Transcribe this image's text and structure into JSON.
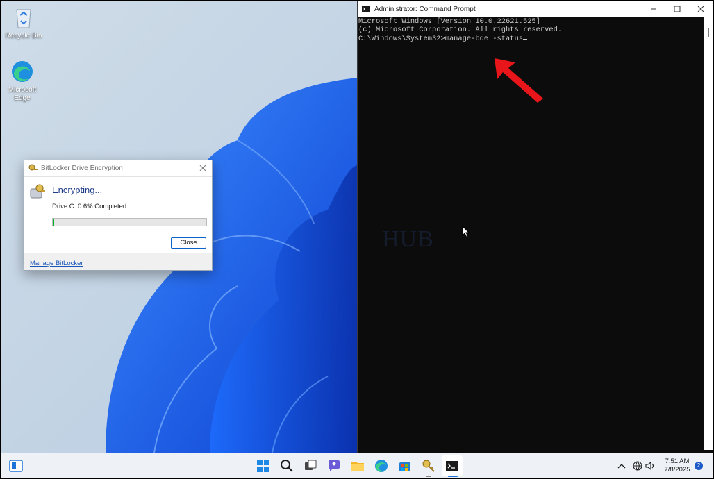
{
  "desktop": {
    "icons": [
      {
        "label": "Recycle Bin",
        "icon": "recycle-bin-icon"
      },
      {
        "label": "Microsoft Edge",
        "icon": "edge-icon"
      }
    ]
  },
  "bitlocker_dialog": {
    "title": "BitLocker Drive Encryption",
    "heading": "Encrypting...",
    "status": "Drive C: 0.6% Completed",
    "progress_percent": 0.6,
    "close_label": "Close",
    "link_label": "Manage BitLocker",
    "colors": {
      "progress": "#06b025",
      "heading": "#1f3c8a",
      "link": "#1a56b8"
    }
  },
  "cmd_window": {
    "title": "Administrator: Command Prompt",
    "lines": [
      "Microsoft Windows [Version 10.0.22621.525]",
      "(c) Microsoft Corporation. All rights reserved.",
      "",
      "C:\\Windows\\System32>manage-bde -status"
    ],
    "annotation": "red-arrow-pointing-to-command",
    "colors": {
      "background": "#0c0c0c",
      "text": "#cccccc",
      "arrow": "#e8161b"
    }
  },
  "watermark": "HUB",
  "taskbar": {
    "icons": [
      "widgets-icon",
      "start-icon",
      "search-icon",
      "task-view-icon",
      "chat-icon",
      "file-explorer-icon",
      "edge-icon",
      "store-icon",
      "bitlocker-icon",
      "cmd-icon"
    ],
    "tray": [
      "chevron-up-icon",
      "network-icon",
      "volume-icon"
    ],
    "time": "7:51 AM",
    "date": "7/8/2025",
    "notification_count": "2"
  }
}
